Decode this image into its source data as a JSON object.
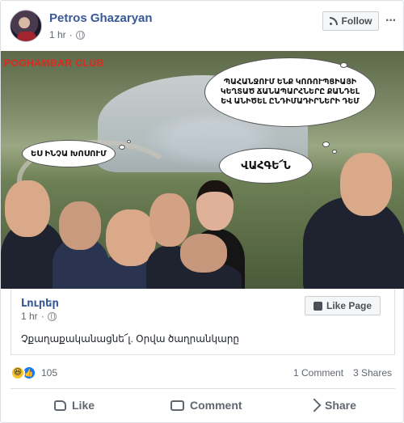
{
  "post": {
    "author": "Petros Ghazaryan",
    "time": "1 hr",
    "follow_label": "Follow",
    "more_label": "···"
  },
  "image": {
    "club_text": "POGHAMBAR CLUB",
    "bubble_main": "ՊԱՀԱՆՋՈՒՄ ԵՆՔ ԿՈՌՈՒՊՑԻԱՅԻ ԿԵՂՏԱԾ ՃԱՆԱՊԱՐՀՆԵՐԸ ՔԱՆԴԵԼ ԵՎ ԱՆԻԾԵԼ ԸՆԴԻՄԱԴԻՐՆԵՐԻ ԴԵՄ",
    "bubble_left": "ԵՍ ԻՆՉԱ ԽՈՍՈՒՄ",
    "bubble_mid": "ՎԱՀԳԵ՜Ն"
  },
  "shared_page": {
    "name": "Լուրեր",
    "time": "1 hr",
    "like_page_label": "Like Page",
    "caption": "Չքաղաքականացնե՜լ. Օրվա ծաղրանկարը"
  },
  "stats": {
    "reactions_count": "105",
    "comments": "1 Comment",
    "shares": "3 Shares"
  },
  "actions": {
    "like": "Like",
    "comment": "Comment",
    "share": "Share"
  },
  "icons": [
    "rss-icon",
    "globe-icon",
    "thumb-icon",
    "haha-icon",
    "like-react-icon",
    "comment-icon",
    "share-icon",
    "more-icon"
  ],
  "colors": {
    "link": "#385898",
    "muted": "#606770",
    "like_blue": "#1877f2",
    "haha_yellow": "#f7c431"
  }
}
